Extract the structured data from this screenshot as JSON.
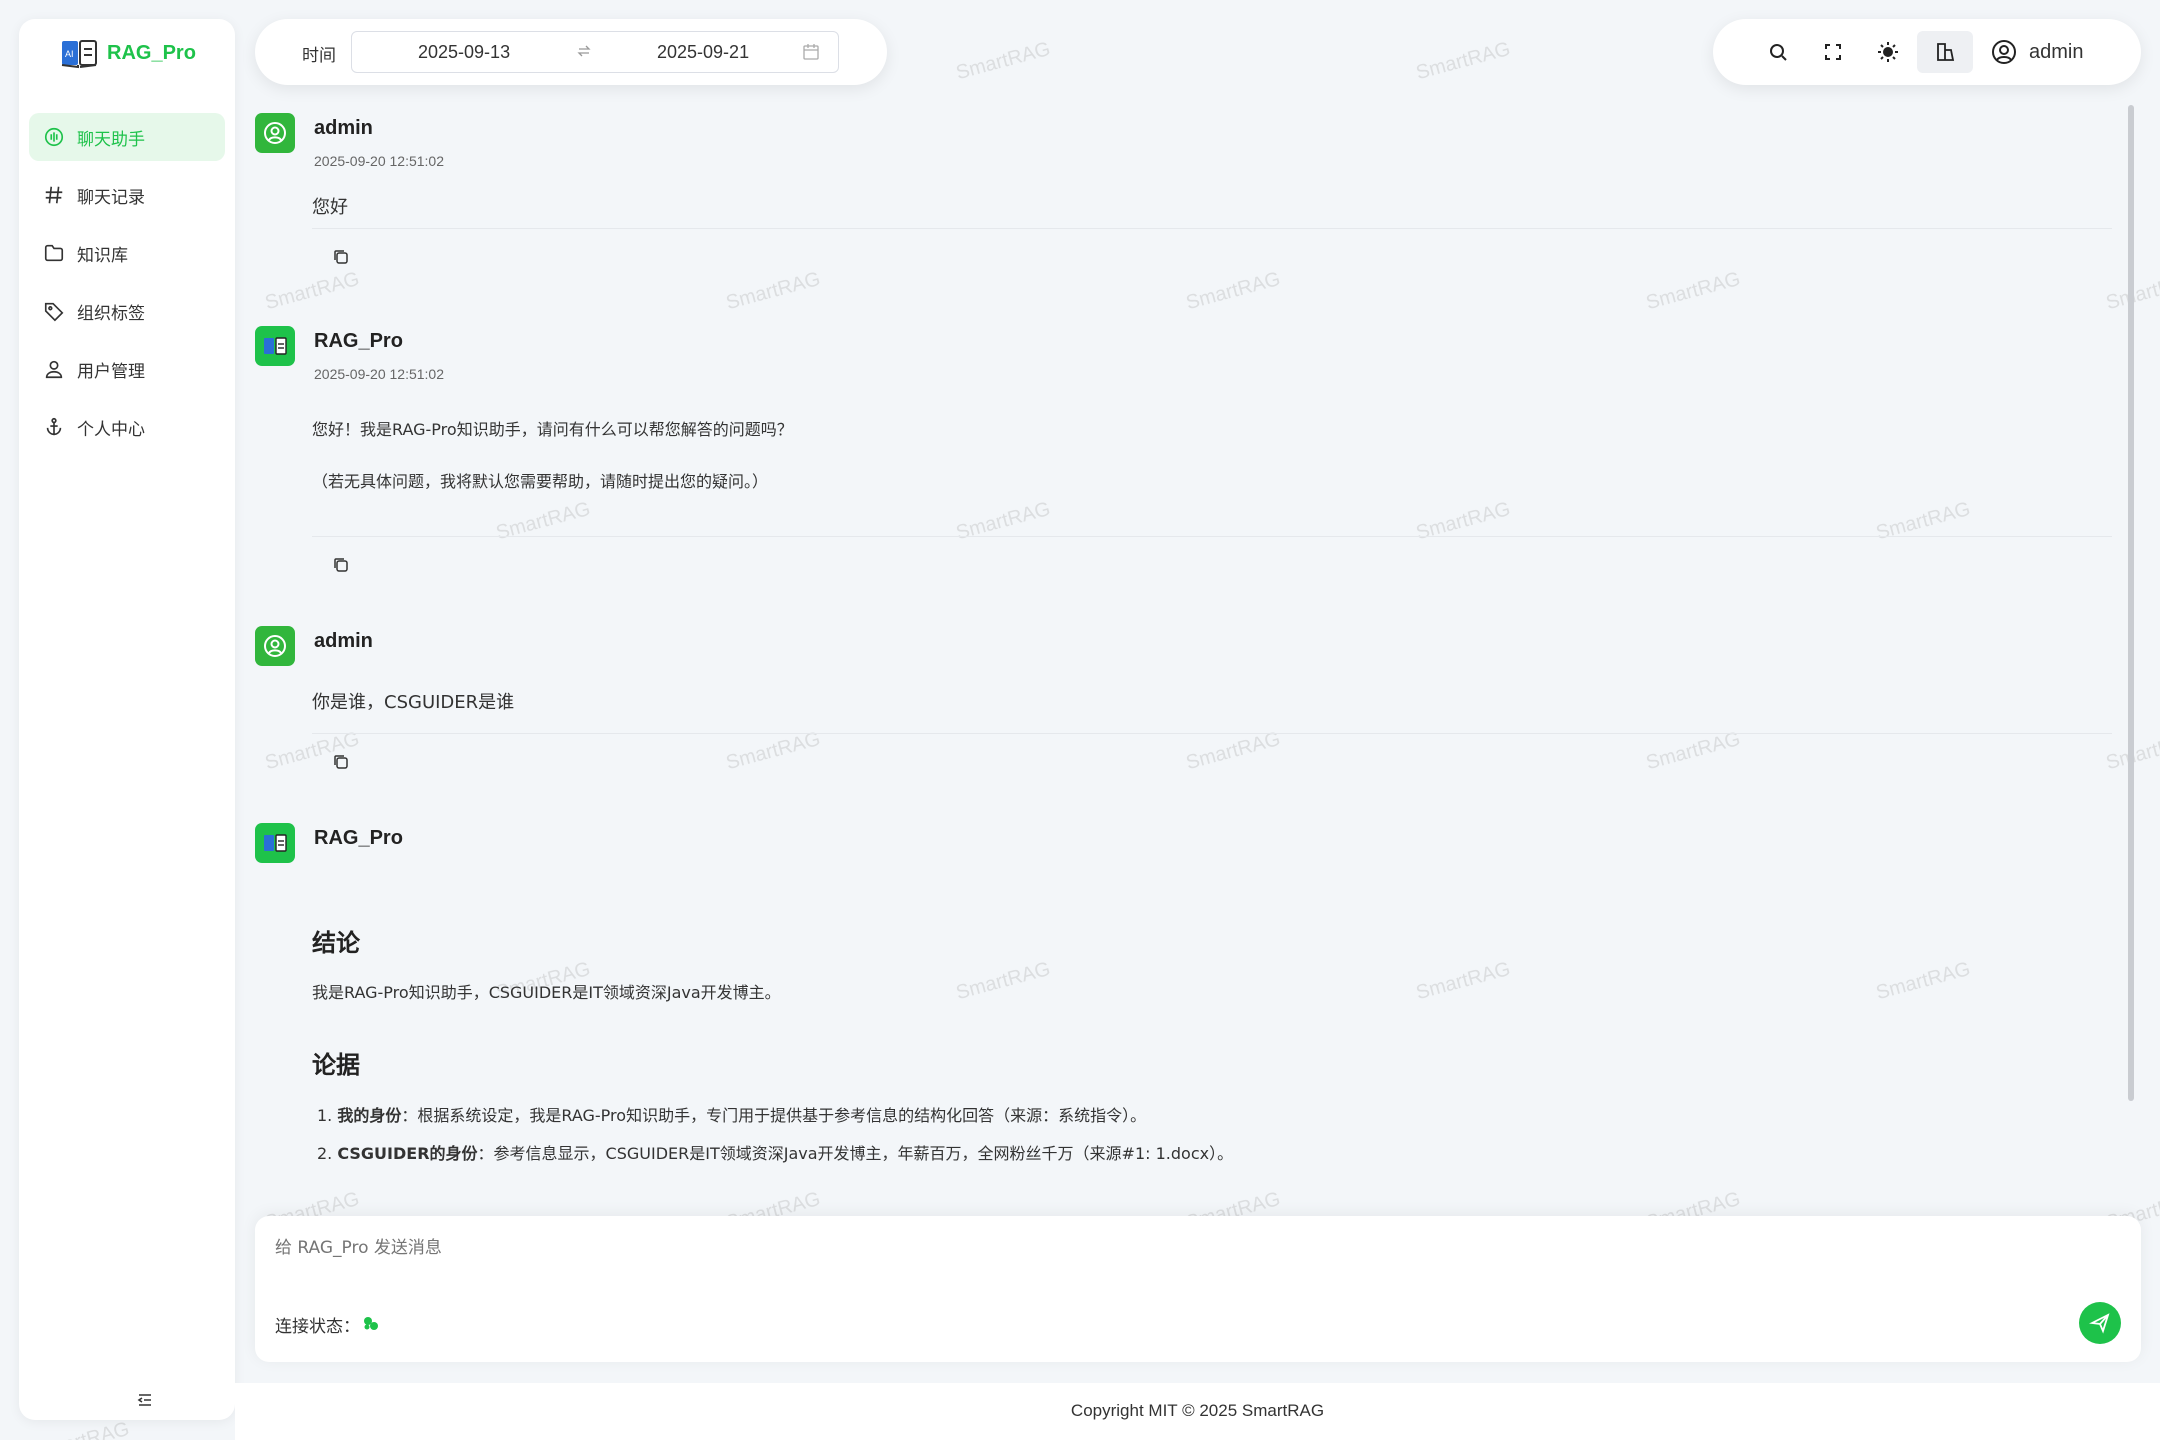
{
  "app": {
    "title": "RAG_Pro",
    "accent": "#1ec24a"
  },
  "sidebar": {
    "items": [
      {
        "label": "聊天助手",
        "icon": "chat-bubble-icon",
        "active": true
      },
      {
        "label": "聊天记录",
        "icon": "hash-icon",
        "active": false
      },
      {
        "label": "知识库",
        "icon": "folder-icon",
        "active": false
      },
      {
        "label": "组织标签",
        "icon": "tag-icon",
        "active": false
      },
      {
        "label": "用户管理",
        "icon": "user-icon",
        "active": false
      },
      {
        "label": "个人中心",
        "icon": "anchor-icon",
        "active": false
      }
    ],
    "collapse_icon": "collapse-menu-icon"
  },
  "datebar": {
    "label": "时间",
    "start": "2025-09-13",
    "end": "2025-09-21"
  },
  "toolbar": {
    "username": "admin"
  },
  "messages": [
    {
      "name": "admin",
      "time": "2025-09-20 12:51:02",
      "text": "您好"
    },
    {
      "name": "RAG_Pro",
      "time": "2025-09-20 12:51:02",
      "line1": "您好！我是RAG-Pro知识助手，请问有什么可以帮您解答的问题吗？",
      "line2": "（若无具体问题，我将默认您需要帮助，请随时提出您的疑问。）"
    },
    {
      "name": "admin",
      "text": "你是谁，CSGUIDER是谁"
    },
    {
      "name": "RAG_Pro",
      "h_conclusion": "结论",
      "conclusion": "我是RAG-Pro知识助手，CSGUIDER是IT领域资深Java开发博主。",
      "h_evidence": "论据",
      "evidence": [
        {
          "num": "1.",
          "bold": "我的身份",
          "rest": "：根据系统设定，我是RAG-Pro知识助手，专门用于提供基于参考信息的结构化回答（来源：系统指令）。"
        },
        {
          "num": "2.",
          "bold": "CSGUIDER的身份",
          "rest": "：参考信息显示，CSGUIDER是IT领域资深Java开发博主，年薪百万，全网粉丝千万（来源#1: 1.docx）。"
        }
      ]
    }
  ],
  "input": {
    "placeholder": "给 RAG_Pro 发送消息",
    "status_label": "连接状态："
  },
  "footer": {
    "copyright": "Copyright MIT © 2025 SmartRAG"
  },
  "watermark": "SmartRAG"
}
